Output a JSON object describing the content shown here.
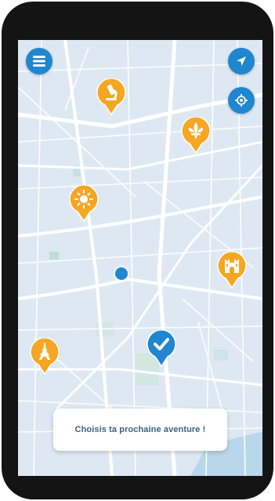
{
  "map": {
    "prompt_text": "Choisis ta prochaine aventure !"
  },
  "controls": {
    "menu_icon": "hamburger-icon",
    "navigate_icon": "navigation-arrow-icon",
    "locate_icon": "target-location-icon"
  },
  "pins": [
    {
      "icon": "microscope-icon",
      "color": "#f5a623"
    },
    {
      "icon": "fleur-de-lis-icon",
      "color": "#f5a623"
    },
    {
      "icon": "sun-icon",
      "color": "#f5a623"
    },
    {
      "icon": "castle-icon",
      "color": "#f5a623"
    },
    {
      "icon": "eiffel-tower-icon",
      "color": "#f5a623"
    },
    {
      "icon": "checkmark-icon",
      "color": "#1f86cf"
    }
  ],
  "colors": {
    "accent_blue": "#1f86cf",
    "pin_orange": "#f5a623",
    "map_background": "#dde8f2",
    "road": "#ffffff",
    "prompt_text": "#3a6280"
  }
}
